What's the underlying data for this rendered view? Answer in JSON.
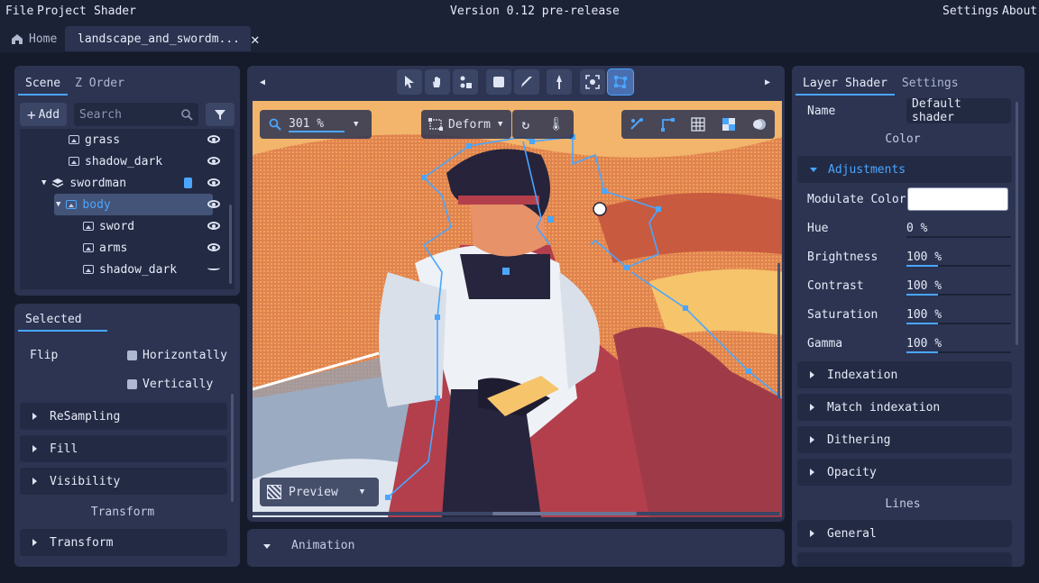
{
  "menu": {
    "file": "File",
    "project": "Project",
    "shader": "Shader",
    "version": "Version 0.12 pre-release",
    "settings": "Settings",
    "about": "About"
  },
  "tabs": {
    "home": "Home",
    "document": "landscape_and_swordm..."
  },
  "scene": {
    "tab_scene": "Scene",
    "tab_zorder": "Z Order",
    "add_label": "Add",
    "search_placeholder": "Search",
    "items": [
      {
        "label": "grass",
        "depth": 2
      },
      {
        "label": "shadow_dark",
        "depth": 2
      },
      {
        "label": "swordman",
        "depth": 1
      },
      {
        "label": "body",
        "depth": 2
      },
      {
        "label": "sword",
        "depth": 3
      },
      {
        "label": "arms",
        "depth": 3
      },
      {
        "label": "shadow_dark",
        "depth": 3
      }
    ]
  },
  "selected": {
    "title": "Selected",
    "flip": "Flip",
    "horizontally": "Horizontally",
    "vertically": "Vertically",
    "resampling": "ReSampling",
    "fill": "Fill",
    "visibility": "Visibility",
    "transform_header": "Transform",
    "transform": "Transform"
  },
  "viewport": {
    "zoom": "301 %",
    "mode": "Deform",
    "preview": "Preview"
  },
  "animation": {
    "label": "Animation"
  },
  "shader": {
    "tab_layer": "Layer Shader",
    "tab_settings": "Settings",
    "name_label": "Name",
    "name_value": "Default shader",
    "color_header": "Color",
    "adjustments": "Adjustments",
    "modulate_color": "Modulate Color",
    "modulate_value": "#ffffff",
    "params": [
      {
        "label": "Hue",
        "value": "0 %",
        "fill": 0
      },
      {
        "label": "Brightness",
        "value": "100 %",
        "fill": 0.3
      },
      {
        "label": "Contrast",
        "value": "100 %",
        "fill": 0.3
      },
      {
        "label": "Saturation",
        "value": "100 %",
        "fill": 0.3
      },
      {
        "label": "Gamma",
        "value": "100 %",
        "fill": 0.3
      }
    ],
    "indexation": "Indexation",
    "match_indexation": "Match indexation",
    "dithering": "Dithering",
    "opacity": "Opacity",
    "lines_header": "Lines",
    "general": "General"
  },
  "colors": {
    "accent": "#4aa6ff",
    "panel": "#2c3452",
    "background": "#161b2b"
  }
}
